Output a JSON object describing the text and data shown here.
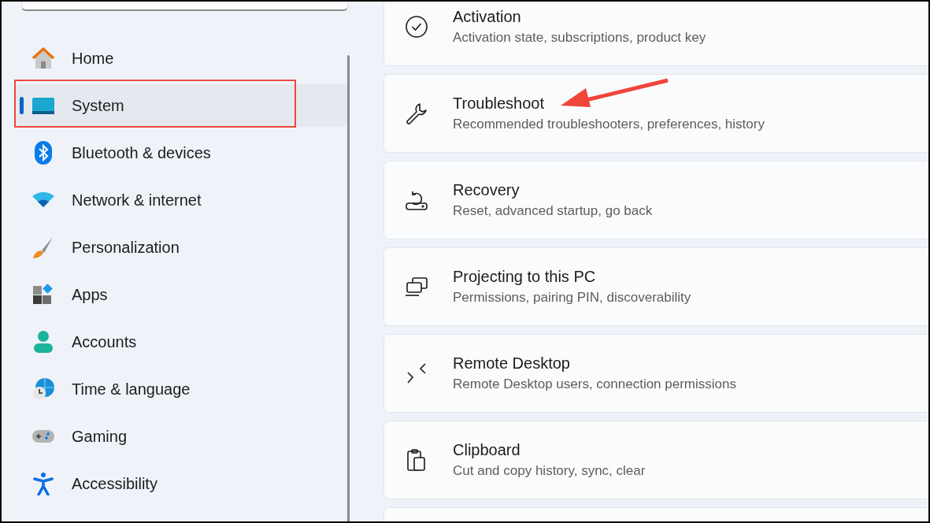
{
  "sidebar": {
    "items": [
      {
        "label": "Home",
        "kind": "home",
        "selected": false
      },
      {
        "label": "System",
        "kind": "system",
        "selected": true
      },
      {
        "label": "Bluetooth & devices",
        "kind": "bluetooth",
        "selected": false
      },
      {
        "label": "Network & internet",
        "kind": "wifi",
        "selected": false
      },
      {
        "label": "Personalization",
        "kind": "brush",
        "selected": false
      },
      {
        "label": "Apps",
        "kind": "apps",
        "selected": false
      },
      {
        "label": "Accounts",
        "kind": "person",
        "selected": false
      },
      {
        "label": "Time & language",
        "kind": "globe",
        "selected": false
      },
      {
        "label": "Gaming",
        "kind": "gamepad",
        "selected": false
      },
      {
        "label": "Accessibility",
        "kind": "accessibility",
        "selected": false
      }
    ]
  },
  "settings": [
    {
      "title": "Activation",
      "description": "Activation state, subscriptions, product key",
      "kind": "check"
    },
    {
      "title": "Troubleshoot",
      "description": "Recommended troubleshooters, preferences, history",
      "kind": "wrench"
    },
    {
      "title": "Recovery",
      "description": "Reset, advanced startup, go back",
      "kind": "recovery"
    },
    {
      "title": "Projecting to this PC",
      "description": "Permissions, pairing PIN, discoverability",
      "kind": "project"
    },
    {
      "title": "Remote Desktop",
      "description": "Remote Desktop users, connection permissions",
      "kind": "remote"
    },
    {
      "title": "Clipboard",
      "description": "Cut and copy history, sync, clear",
      "kind": "clipboard"
    }
  ]
}
